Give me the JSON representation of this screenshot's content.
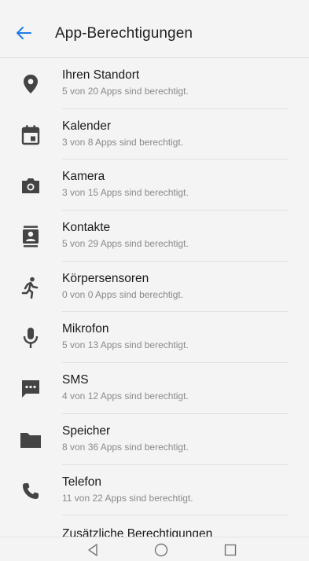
{
  "header": {
    "title": "App-Berechtigungen",
    "back_icon": "arrow-left-icon",
    "accent_color": "#1e7be6"
  },
  "permissions": [
    {
      "icon": "location-pin-icon",
      "label": "Ihren Standort",
      "subtitle": "5 von 20 Apps sind berechtigt."
    },
    {
      "icon": "calendar-icon",
      "label": "Kalender",
      "subtitle": "3 von 8 Apps sind berechtigt."
    },
    {
      "icon": "camera-icon",
      "label": "Kamera",
      "subtitle": "3 von 15 Apps sind berechtigt."
    },
    {
      "icon": "contacts-icon",
      "label": "Kontakte",
      "subtitle": "5 von 29 Apps sind berechtigt."
    },
    {
      "icon": "body-sensor-icon",
      "label": "Körpersensoren",
      "subtitle": "0 von 0 Apps sind berechtigt."
    },
    {
      "icon": "microphone-icon",
      "label": "Mikrofon",
      "subtitle": "5 von 13 Apps sind berechtigt."
    },
    {
      "icon": "sms-icon",
      "label": "SMS",
      "subtitle": "4 von 12 Apps sind berechtigt."
    },
    {
      "icon": "folder-icon",
      "label": "Speicher",
      "subtitle": "8 von 36 Apps sind berechtigt."
    },
    {
      "icon": "phone-icon",
      "label": "Telefon",
      "subtitle": "11 von 22 Apps sind berechtigt."
    }
  ],
  "partial_item": {
    "label": "Zusätzliche Berechtigungen"
  },
  "navbar": {
    "back": "nav-back-icon",
    "home": "nav-home-icon",
    "recents": "nav-recents-icon"
  }
}
